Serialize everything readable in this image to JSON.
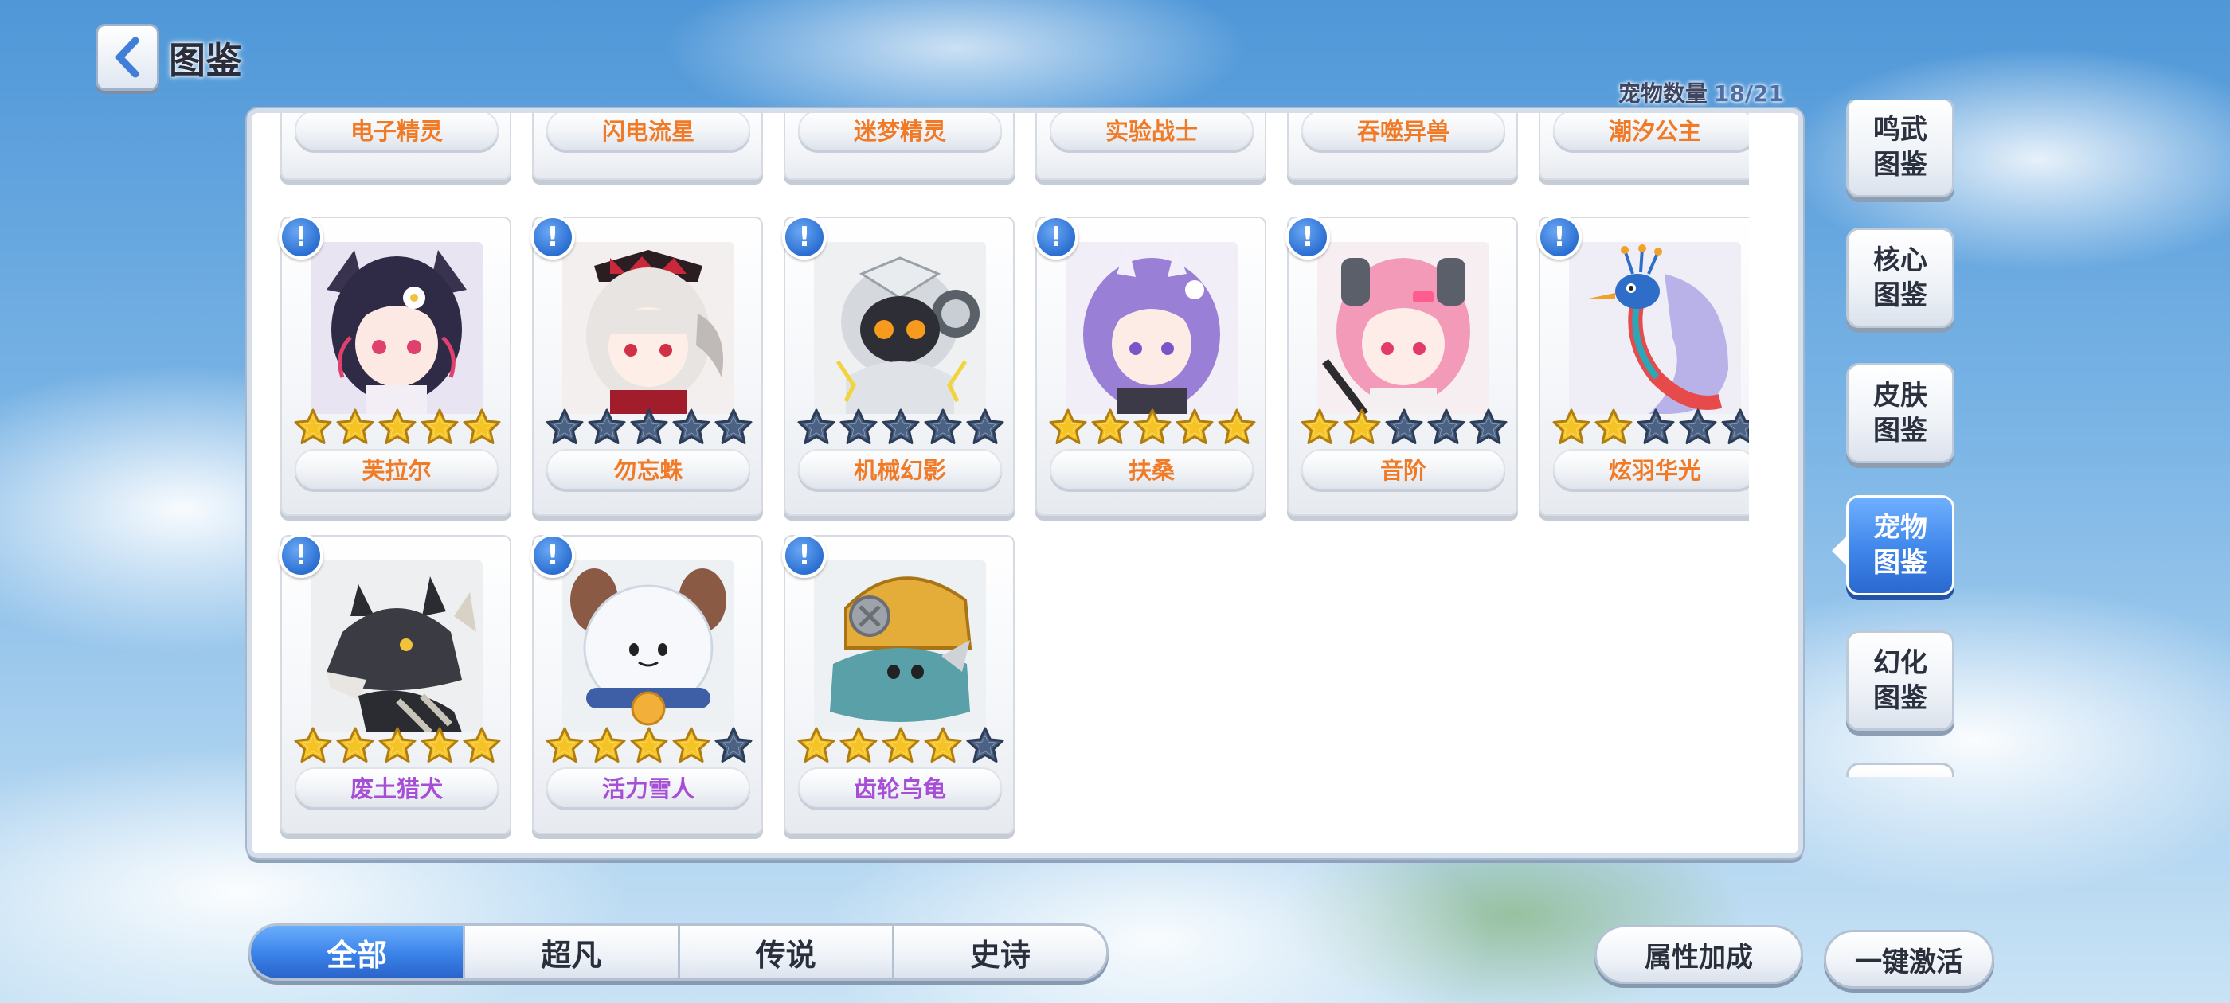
{
  "header": {
    "title": "图鉴"
  },
  "pet_count": {
    "label": "宠物数量",
    "value": "18/21"
  },
  "partial_row": [
    {
      "name": "电子精灵"
    },
    {
      "name": "闪电流星"
    },
    {
      "name": "迷梦精灵"
    },
    {
      "name": "实验战士"
    },
    {
      "name": "吞噬异兽"
    },
    {
      "name": "潮汐公主"
    }
  ],
  "pets": [
    {
      "name": "芙拉尔",
      "stars": 5,
      "name_color": "orange",
      "icon": "pet-portrait-dark-hair-girl-icon"
    },
    {
      "name": "勿忘蛛",
      "stars": 0,
      "name_color": "orange",
      "icon": "pet-portrait-white-hair-girl-icon"
    },
    {
      "name": "机械幻影",
      "stars": 0,
      "name_color": "orange",
      "icon": "pet-portrait-robot-icon"
    },
    {
      "name": "扶桑",
      "stars": 5,
      "name_color": "orange",
      "icon": "pet-portrait-purple-oni-girl-icon"
    },
    {
      "name": "音阶",
      "stars": 2,
      "name_color": "orange",
      "icon": "pet-portrait-pink-hair-girl-icon"
    },
    {
      "name": "炫羽华光",
      "stars": 2,
      "name_color": "orange",
      "icon": "pet-portrait-peacock-icon"
    },
    {
      "name": "废土猎犬",
      "stars": 5,
      "name_color": "purple",
      "icon": "pet-portrait-wolf-icon"
    },
    {
      "name": "活力雪人",
      "stars": 4,
      "name_color": "purple",
      "icon": "pet-portrait-snowman-icon"
    },
    {
      "name": "齿轮乌龟",
      "stars": 4,
      "name_color": "purple",
      "icon": "pet-portrait-gear-turtle-icon"
    }
  ],
  "alert_mark": "!",
  "side_tabs": [
    {
      "label": "鸣武\n图鉴",
      "active": false
    },
    {
      "label": "核心\n图鉴",
      "active": false
    },
    {
      "label": "皮肤\n图鉴",
      "active": false
    },
    {
      "label": "宠物\n图鉴",
      "active": true
    },
    {
      "label": "幻化\n图鉴",
      "active": false
    }
  ],
  "filter_tabs": [
    {
      "label": "全部",
      "active": true
    },
    {
      "label": "超凡",
      "active": false
    },
    {
      "label": "传说",
      "active": false
    },
    {
      "label": "史诗",
      "active": false
    }
  ],
  "buttons": {
    "attribute_bonus": "属性加成",
    "one_click_activate": "一键激活"
  },
  "colors": {
    "name_orange": "#f07a26",
    "name_purple": "#a64fd6",
    "star_gold": "#f6c325",
    "star_empty": "#4b6285",
    "accent_blue": "#3a82e8"
  }
}
